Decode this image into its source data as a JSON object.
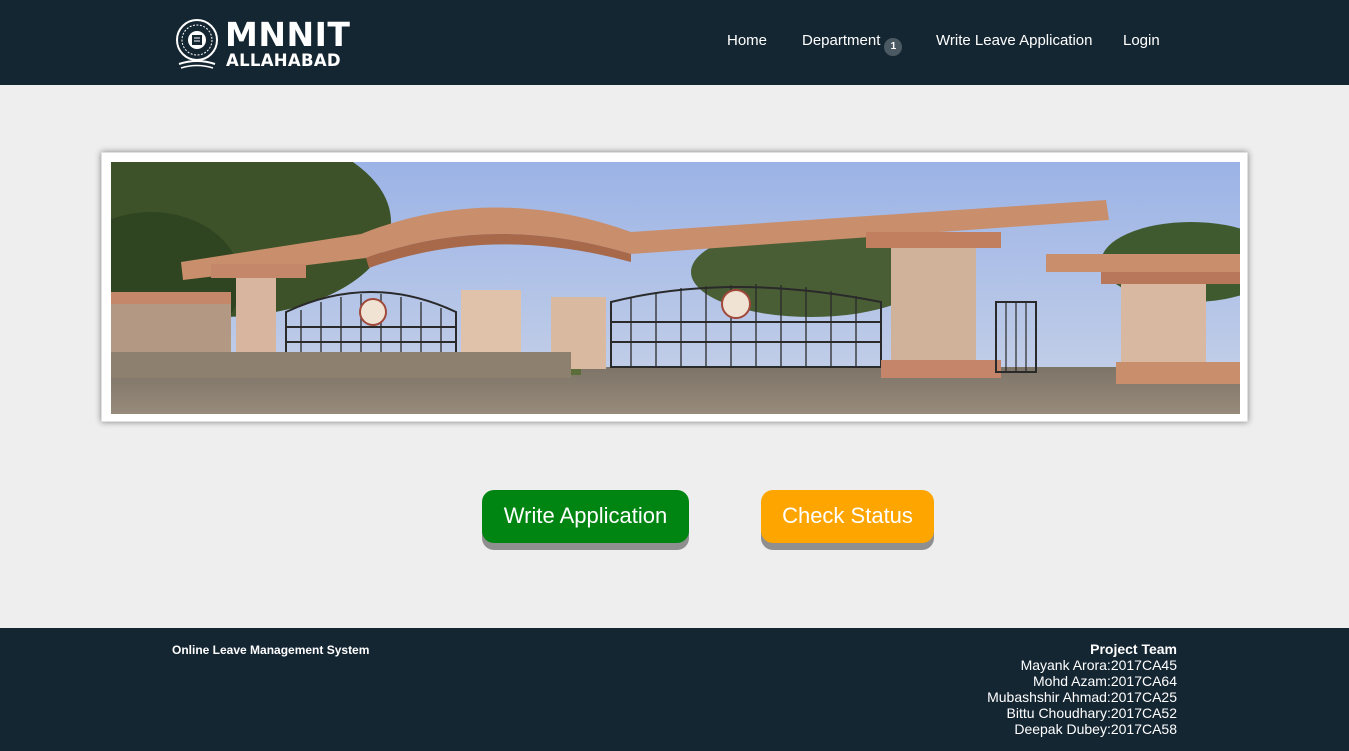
{
  "header": {
    "logo_text_main": "MNNIT",
    "logo_text_sub": "ALLAHABAD",
    "nav": [
      {
        "label": "Home"
      },
      {
        "label": "Department",
        "badge": "1"
      },
      {
        "label": "Write Leave Application"
      },
      {
        "label": "Login"
      }
    ]
  },
  "actions": {
    "write_label": "Write Application",
    "status_label": "Check Status"
  },
  "footer": {
    "title": "Online Leave Management System",
    "team_heading": "Project Team",
    "team": [
      "Mayank Arora:2017CA45",
      "Mohd Azam:2017CA64",
      "Mubashshir Ahmad:2017CA25",
      "Bittu Choudhary:2017CA52",
      "Deepak Dubey:2017CA58"
    ]
  },
  "colors": {
    "header_bg": "#152633",
    "page_bg": "#eeeeee",
    "write_button": "#008512",
    "status_button": "#ffa500"
  }
}
